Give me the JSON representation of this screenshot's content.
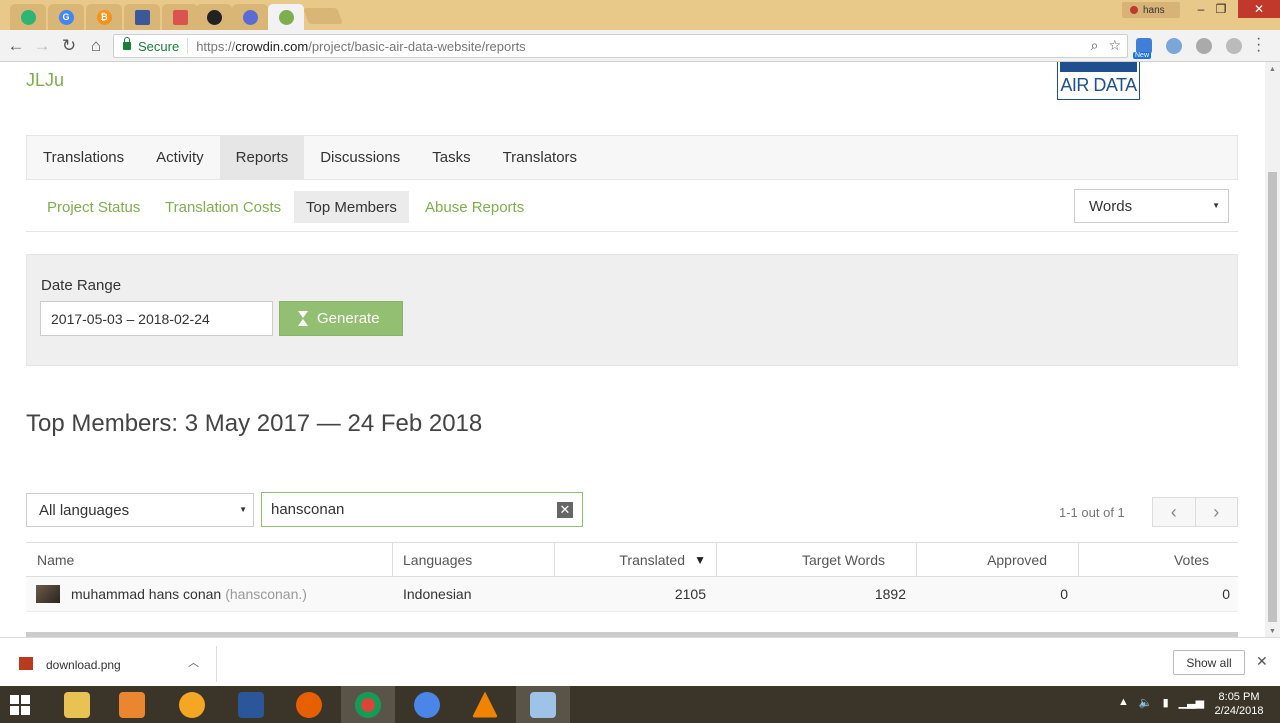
{
  "browser": {
    "tabs": [
      {
        "name": "tab-1",
        "color": "#2bb673"
      },
      {
        "name": "tab-google",
        "color": "#4285f4"
      },
      {
        "name": "tab-bitcoin",
        "color": "#f7931a"
      },
      {
        "name": "tab-4",
        "color": "#3b5998"
      },
      {
        "name": "tab-5",
        "color": "#d9534f"
      },
      {
        "name": "tab-github",
        "color": "#222222"
      },
      {
        "name": "tab-7",
        "color": "#5b6bd5"
      },
      {
        "name": "tab-crowdin",
        "color": "#7fae4f"
      }
    ],
    "profile_name": "hans",
    "secure_label": "Secure",
    "url_scheme": "https://",
    "url_host": "crowdin.com",
    "url_path": "/project/basic-air-data-website/reports",
    "ext_new_badge": "New"
  },
  "page": {
    "user_title": "JLJu",
    "logo_text": "AIR DATA",
    "main_nav": [
      "Translations",
      "Activity",
      "Reports",
      "Discussions",
      "Tasks",
      "Translators"
    ],
    "main_nav_active": "Reports",
    "sub_nav": [
      "Project Status",
      "Translation Costs",
      "Top Members",
      "Abuse Reports"
    ],
    "sub_nav_active": "Top Members",
    "units_select": "Words",
    "date_range_label": "Date Range",
    "date_range_value": "2017-05-03 – 2018-02-24",
    "generate_label": "Generate",
    "heading": "Top Members: 3 May 2017 — 24 Feb 2018",
    "language_filter": "All languages",
    "search_value": "hansconan",
    "pagination_text": "1-1 out of 1",
    "table": {
      "columns": [
        "Name",
        "Languages",
        "Translated",
        "Target Words",
        "Approved",
        "Votes"
      ],
      "rows": [
        {
          "name": "muhammad hans conan",
          "login": "(hansconan.)",
          "languages": "Indonesian",
          "translated": "2105",
          "target_words": "1892",
          "approved": "0",
          "votes": "0"
        }
      ]
    }
  },
  "downloads": {
    "file_name": "download.png",
    "show_all": "Show all"
  },
  "taskbar": {
    "time": "8:05 PM",
    "date": "2/24/2018"
  },
  "colors": {
    "accent_green": "#7fae4f",
    "button_green": "#93bf73",
    "logo_blue": "#1f4f8f"
  }
}
